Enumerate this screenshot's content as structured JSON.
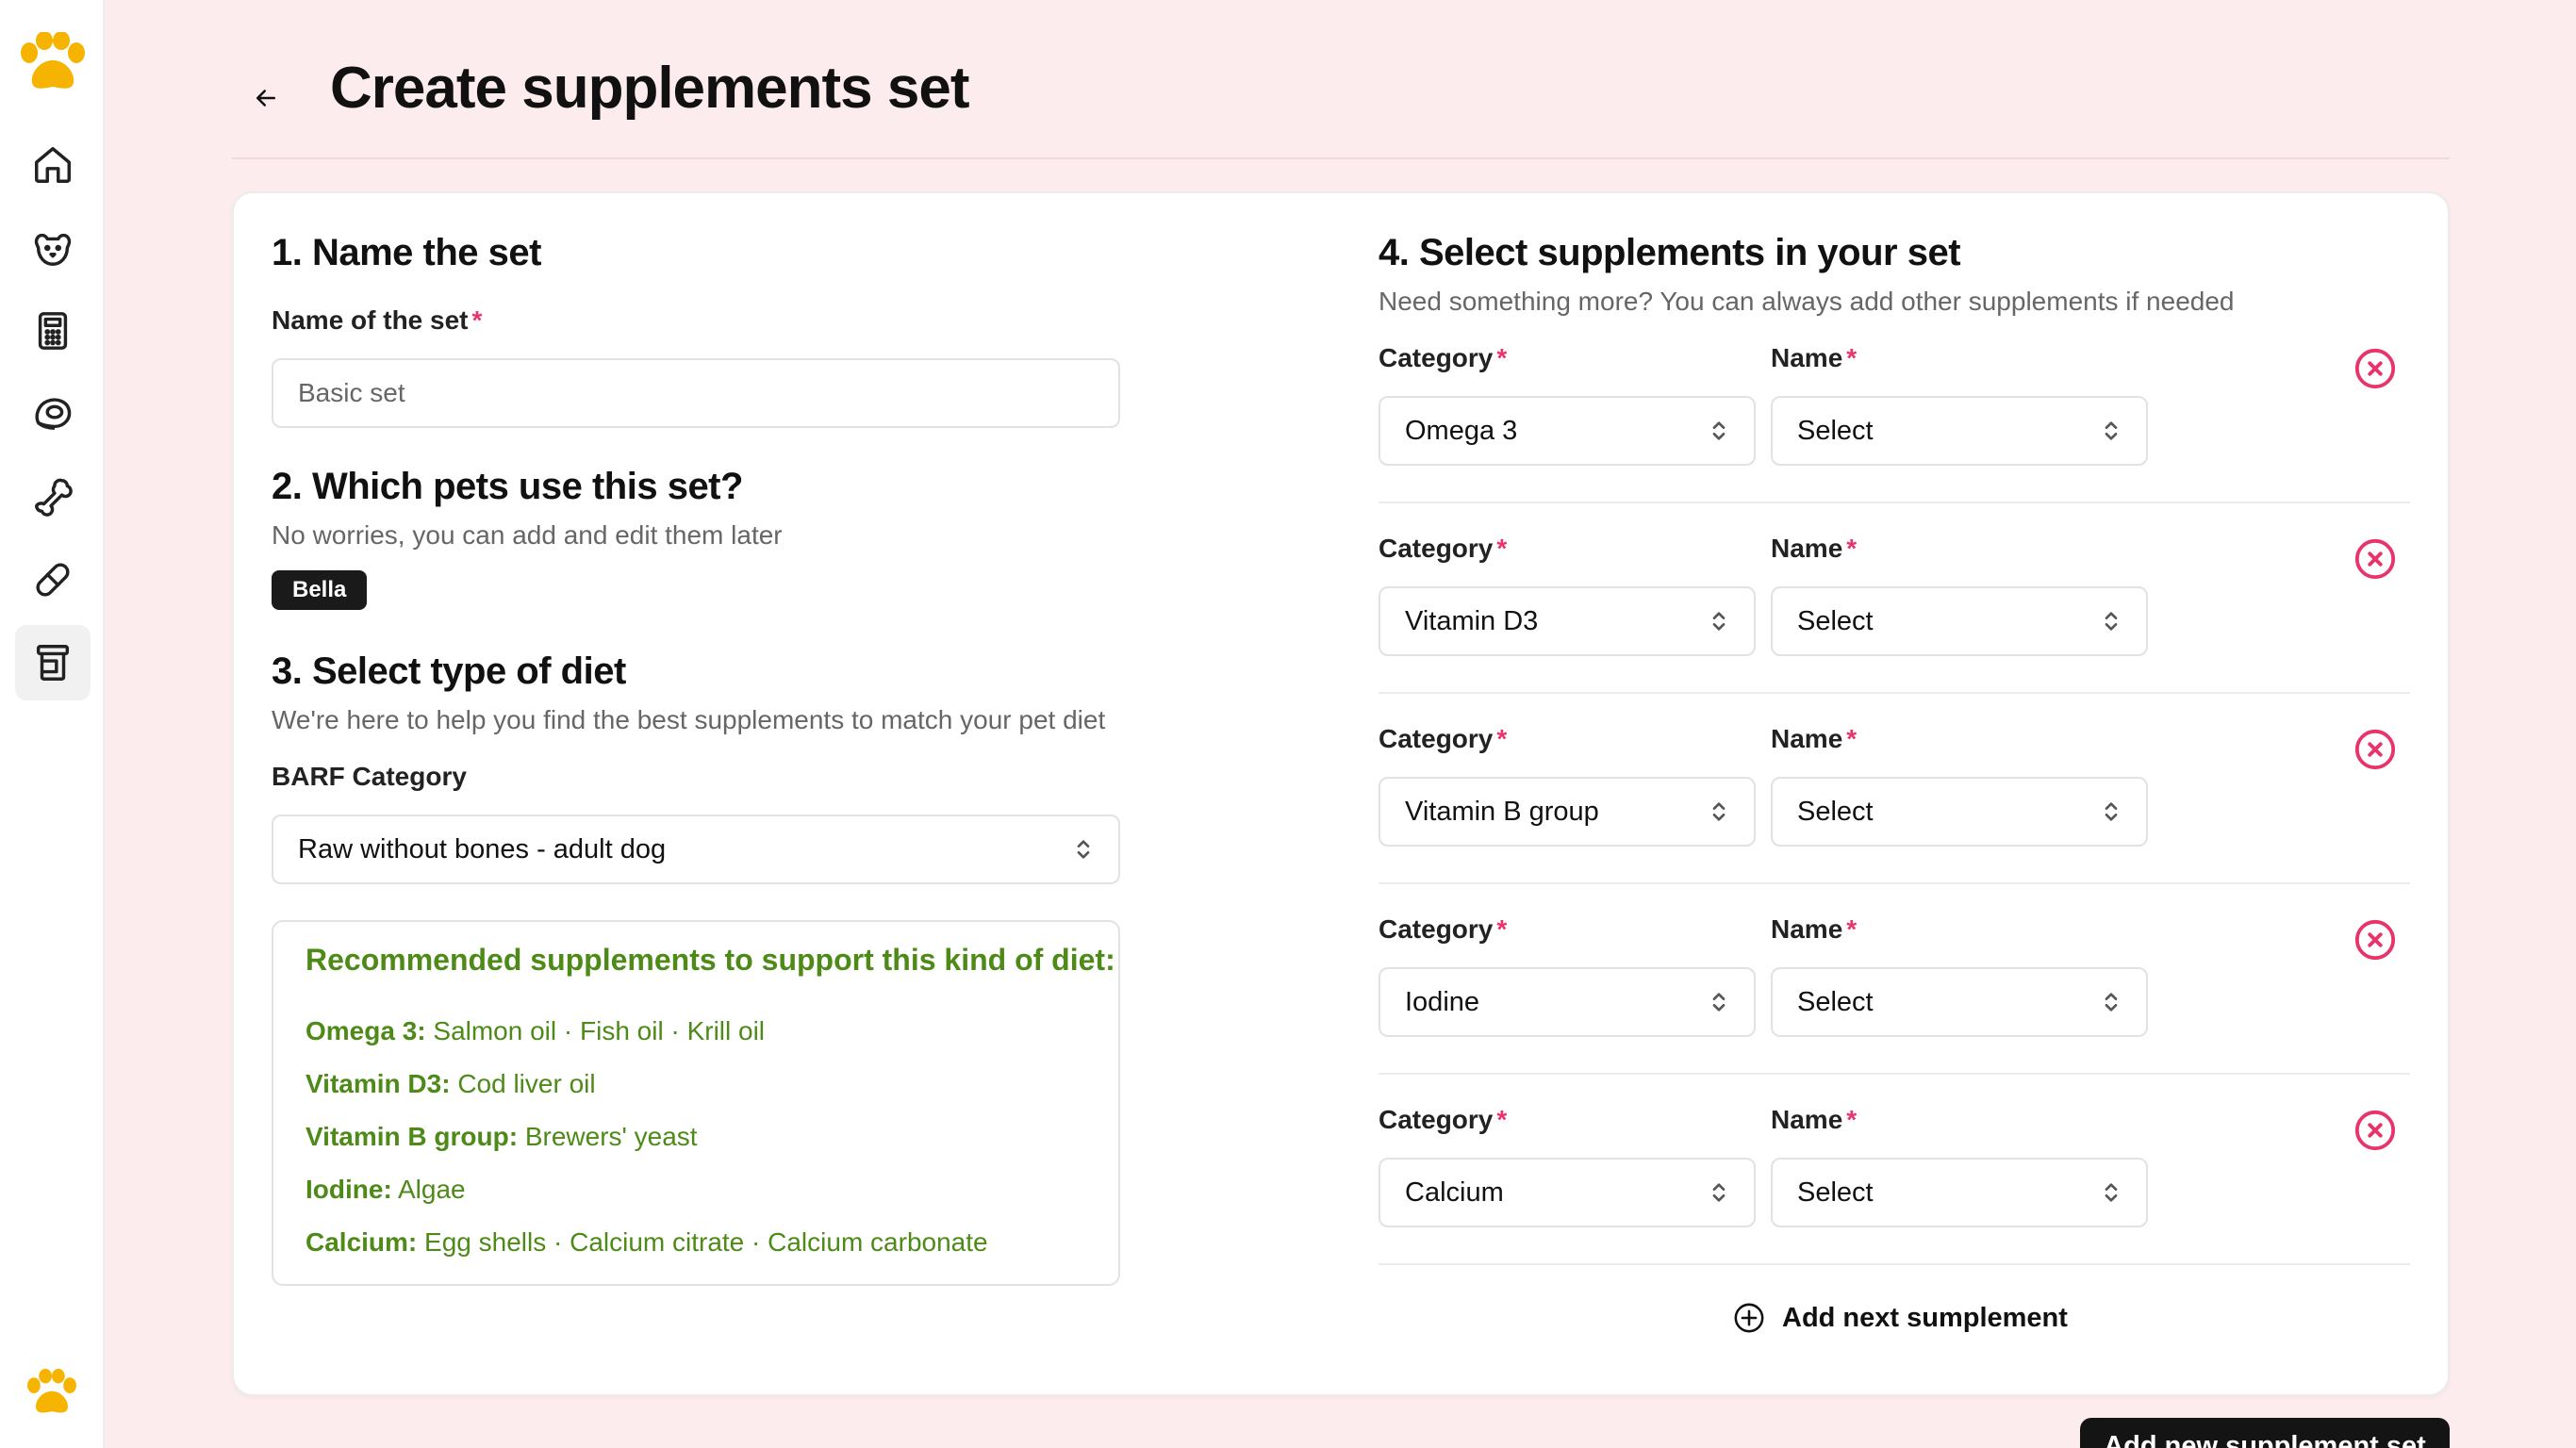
{
  "app": {
    "brand_color": "#f6b400",
    "accent_required": "#e8336b",
    "recommend_color": "#4d8a17"
  },
  "sidebar": {
    "items": [
      {
        "icon": "home-icon"
      },
      {
        "icon": "dog-face-icon"
      },
      {
        "icon": "calculator-icon"
      },
      {
        "icon": "meat-icon"
      },
      {
        "icon": "bone-icon"
      },
      {
        "icon": "pill-icon"
      },
      {
        "icon": "supplement-jar-icon",
        "active": true
      }
    ]
  },
  "header": {
    "title": "Create supplements set"
  },
  "section1": {
    "title": "1. Name the set",
    "field_label": "Name of the set",
    "required_mark": "*",
    "field_placeholder": "Basic set"
  },
  "section2": {
    "title": "2. Which pets use this set?",
    "subtitle": "No worries, you can add and edit them later",
    "pets": [
      "Bella"
    ]
  },
  "section3": {
    "title": "3. Select type of diet",
    "subtitle": "We're here to help you find the best supplements to match your pet diet",
    "field_label": "BARF Category",
    "field_value": "Raw without bones - adult dog",
    "recommendation": {
      "title": "Recommended supplements to support this kind of diet:",
      "items": [
        {
          "name": "Omega 3:",
          "values": "Salmon oil · Fish oil · Krill oil"
        },
        {
          "name": "Vitamin D3:",
          "values": "Cod liver oil"
        },
        {
          "name": "Vitamin B group:",
          "values": "Brewers' yeast"
        },
        {
          "name": "Iodine:",
          "values": "Algae"
        },
        {
          "name": "Calcium:",
          "values": "Egg shells · Calcium citrate · Calcium carbonate"
        }
      ]
    }
  },
  "section4": {
    "title": "4. Select supplements in your set",
    "subtitle": "Need something more? You can always add other supplements if needed",
    "category_label": "Category",
    "name_label": "Name",
    "required_mark": "*",
    "rows": [
      {
        "category": "Omega 3",
        "name": "Select"
      },
      {
        "category": "Vitamin D3",
        "name": "Select"
      },
      {
        "category": "Vitamin B group",
        "name": "Select"
      },
      {
        "category": "Iodine",
        "name": "Select"
      },
      {
        "category": "Calcium",
        "name": "Select"
      }
    ],
    "add_next_label": "Add next sumplement"
  },
  "footer": {
    "primary_button": "Add new supplement set"
  }
}
